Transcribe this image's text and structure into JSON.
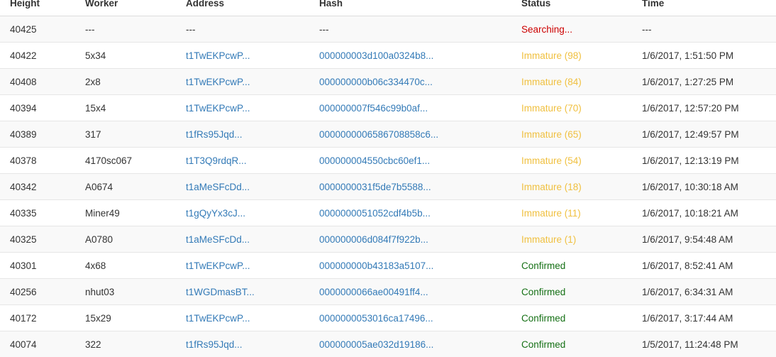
{
  "columns": [
    "Height",
    "Worker",
    "Address",
    "Hash",
    "Status",
    "Time"
  ],
  "status_colors": {
    "searching": "#cc0000",
    "immature": "#f0c040",
    "confirmed": "#157015",
    "link": "#337ab7"
  },
  "rows": [
    {
      "height": "40425",
      "worker": "---",
      "address": "---",
      "hash": "---",
      "status": "Searching...",
      "status_type": "searching",
      "time": "---"
    },
    {
      "height": "40422",
      "worker": "5x34",
      "address": "t1TwEKPcwP...",
      "hash": "000000003d100a0324b8...",
      "status": "Immature (98)",
      "status_type": "immature",
      "time": "1/6/2017, 1:51:50 PM"
    },
    {
      "height": "40408",
      "worker": "2x8",
      "address": "t1TwEKPcwP...",
      "hash": "000000000b06c334470c...",
      "status": "Immature (84)",
      "status_type": "immature",
      "time": "1/6/2017, 1:27:25 PM"
    },
    {
      "height": "40394",
      "worker": "15x4",
      "address": "t1TwEKPcwP...",
      "hash": "000000007f546c99b0af...",
      "status": "Immature (70)",
      "status_type": "immature",
      "time": "1/6/2017, 12:57:20 PM"
    },
    {
      "height": "40389",
      "worker": "317",
      "address": "t1fRs95Jqd...",
      "hash": "0000000006586708858c6...",
      "status": "Immature (65)",
      "status_type": "immature",
      "time": "1/6/2017, 12:49:57 PM"
    },
    {
      "height": "40378",
      "worker": "4170sc067",
      "address": "t1T3Q9rdqR...",
      "hash": "000000004550cbc60ef1...",
      "status": "Immature (54)",
      "status_type": "immature",
      "time": "1/6/2017, 12:13:19 PM"
    },
    {
      "height": "40342",
      "worker": "A0674",
      "address": "t1aMeSFcDd...",
      "hash": "0000000031f5de7b5588...",
      "status": "Immature (18)",
      "status_type": "immature",
      "time": "1/6/2017, 10:30:18 AM"
    },
    {
      "height": "40335",
      "worker": "Miner49",
      "address": "t1gQyYx3cJ...",
      "hash": "0000000051052cdf4b5b...",
      "status": "Immature (11)",
      "status_type": "immature",
      "time": "1/6/2017, 10:18:21 AM"
    },
    {
      "height": "40325",
      "worker": "A0780",
      "address": "t1aMeSFcDd...",
      "hash": "000000006d084f7f922b...",
      "status": "Immature (1)",
      "status_type": "immature",
      "time": "1/6/2017, 9:54:48 AM"
    },
    {
      "height": "40301",
      "worker": "4x68",
      "address": "t1TwEKPcwP...",
      "hash": "000000000b43183a5107...",
      "status": "Confirmed",
      "status_type": "confirmed",
      "time": "1/6/2017, 8:52:41 AM"
    },
    {
      "height": "40256",
      "worker": "nhut03",
      "address": "t1WGDmasBT...",
      "hash": "0000000066ae00491ff4...",
      "status": "Confirmed",
      "status_type": "confirmed",
      "time": "1/6/2017, 6:34:31 AM"
    },
    {
      "height": "40172",
      "worker": "15x29",
      "address": "t1TwEKPcwP...",
      "hash": "0000000053016ca17496...",
      "status": "Confirmed",
      "status_type": "confirmed",
      "time": "1/6/2017, 3:17:44 AM"
    },
    {
      "height": "40074",
      "worker": "322",
      "address": "t1fRs95Jqd...",
      "hash": "000000005ae032d19186...",
      "status": "Confirmed",
      "status_type": "confirmed",
      "time": "1/5/2017, 11:24:48 PM"
    }
  ]
}
